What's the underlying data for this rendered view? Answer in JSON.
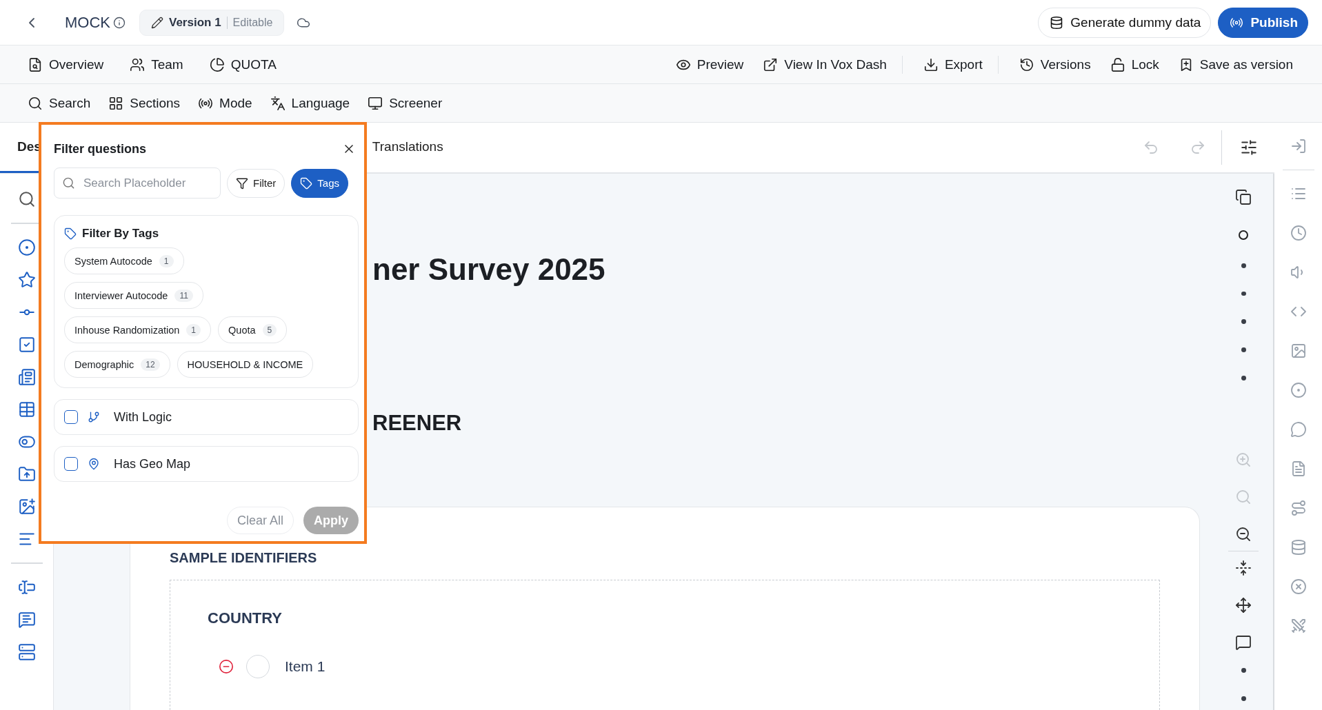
{
  "app_bar": {
    "title": "MOCK",
    "version": {
      "name": "Version 1",
      "status": "Editable"
    },
    "actions": [
      {
        "label": "Generate dummy data",
        "kind": "secondary"
      },
      {
        "label": "Publish",
        "kind": "primary"
      }
    ]
  },
  "nav": {
    "left": [
      "Overview",
      "Team",
      "QUOTA"
    ],
    "right_groups": [
      [
        "Preview",
        "View In Vox Dash"
      ],
      [
        "Export"
      ],
      [
        "Versions",
        "Lock",
        "Save as version"
      ]
    ]
  },
  "toolbar": [
    "Search",
    "Sections",
    "Mode",
    "Language",
    "Screener"
  ],
  "editor": {
    "tabs": [
      {
        "label": "Des",
        "selected": true
      },
      {
        "label": "Translations",
        "selected": false
      }
    ],
    "title": "ner Survey 2025",
    "section": "REENER",
    "card": {
      "heading": "SAMPLE IDENTIFIERS",
      "question": "COUNTRY",
      "items": [
        {
          "label": "Item 1",
          "selected": false
        }
      ]
    }
  },
  "filter_panel": {
    "title": "Filter questions",
    "search": {
      "placeholder": "Search Placeholder"
    },
    "modes": [
      {
        "label": "Filter",
        "selected": false
      },
      {
        "label": "Tags",
        "selected": true
      }
    ],
    "tags_title": "Filter By Tags",
    "tags": [
      {
        "label": "System Autocode",
        "count": "1"
      },
      {
        "label": "Interviewer Autocode",
        "count": "11"
      },
      {
        "label": "Inhouse Randomization",
        "count": "1"
      },
      {
        "label": "Quota",
        "count": "5"
      },
      {
        "label": "Demographic",
        "count": "12"
      },
      {
        "label": "HOUSEHOLD & INCOME"
      }
    ],
    "options": [
      {
        "label": "With Logic",
        "checked": false
      },
      {
        "label": "Has Geo Map",
        "checked": false
      }
    ],
    "buttons": [
      {
        "label": "Clear All",
        "kind": "ghost",
        "disabled": false
      },
      {
        "label": "Apply",
        "kind": "primary",
        "disabled": true
      }
    ]
  }
}
